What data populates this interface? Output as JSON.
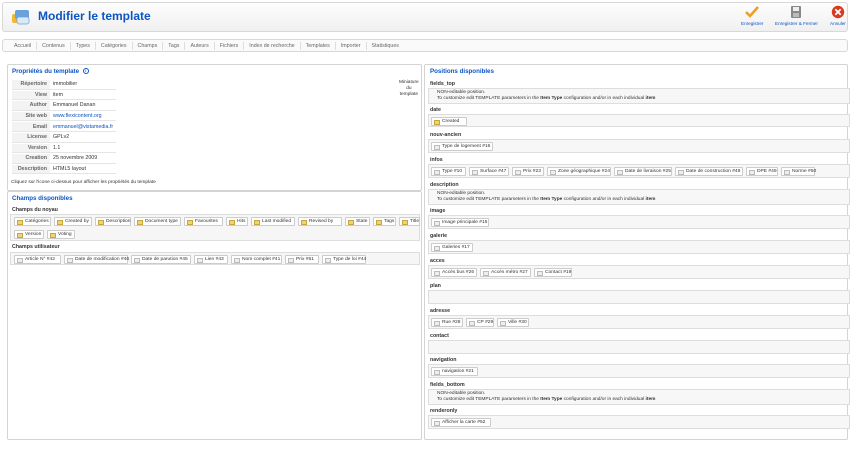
{
  "header": {
    "title": "Modifier le template",
    "toolbar": {
      "save": "Enregistrer",
      "save_close": "Enregistrer & Fermer",
      "cancel": "Annuler"
    }
  },
  "nav": [
    "Accueil",
    "Contenus",
    "Types",
    "Catégories",
    "Champs",
    "Tags",
    "Auteurs",
    "Fichiers",
    "Index de recherche",
    "Templates",
    "Importer",
    "Statistiques"
  ],
  "properties": {
    "title": "Propriétés du template",
    "rows": [
      {
        "k": "Répertoire",
        "v": "immobilier"
      },
      {
        "k": "View",
        "v": "item"
      },
      {
        "k": "Author",
        "v": "Emmanuel Danan"
      },
      {
        "k": "Site web",
        "v": "www.flexicontent.org",
        "link": true
      },
      {
        "k": "Email",
        "v": "emmanuel@vistamedia.fr",
        "link": true
      },
      {
        "k": "License",
        "v": "GPLv2"
      },
      {
        "k": "Version",
        "v": "1.1"
      },
      {
        "k": "Creation",
        "v": "25 novembre 2009"
      },
      {
        "k": "Description",
        "v": "HTML5 layout"
      }
    ],
    "help": "Cliquez sur l'icone ci-dessus pour afficher les propriétés du template",
    "thumb_label": [
      "Miniature",
      "du",
      "template"
    ]
  },
  "available": {
    "title": "Champs disponibles",
    "core_title": "Champs du noyau",
    "core": [
      "Catégories",
      "Created by",
      "Description",
      "Document type",
      "Favourites",
      "Hits",
      "Last modified",
      "Revised by",
      "State",
      "Tags",
      "Title",
      "Version",
      "Voting"
    ],
    "user_title": "Champs utilisateur",
    "user": [
      "Article N° #42",
      "Date de modification #46",
      "Date de parution #45",
      "Lien #43",
      "Nom complet #41",
      "Prix #51",
      "Type de loi #44"
    ]
  },
  "positions": {
    "title": "Positions disponibles",
    "note1": "NON-editable position.",
    "note2a": "To customize edit TEMPLATE parameters in the ",
    "note2b": "Item Type",
    "note2c": " configuration and/or in each individual ",
    "note2d": "item",
    "list": [
      {
        "name": "fields_top",
        "note": true
      },
      {
        "name": "date",
        "items": [
          "Created"
        ]
      },
      {
        "name": "nouv-ancien",
        "items": [
          "Type de logement #16"
        ]
      },
      {
        "name": "infos",
        "items": [
          "Type #10",
          "Surface #47",
          "Prix #23",
          "Zone géographique #24",
          "Date de livraison #25",
          "Date de construction #48",
          "DPE #49",
          "Norme #50"
        ]
      },
      {
        "name": "description",
        "note": true
      },
      {
        "name": "image",
        "items": [
          "Image principale #15"
        ]
      },
      {
        "name": "galerie",
        "items": [
          "Galeries #17"
        ]
      },
      {
        "name": "acces",
        "items": [
          "Accès bus #26",
          "Accès métro #27",
          "Contact #19"
        ]
      },
      {
        "name": "plan",
        "items": []
      },
      {
        "name": "adresse",
        "items": [
          "Rue #28",
          "CP #29",
          "Ville #30"
        ]
      },
      {
        "name": "contact",
        "items": []
      },
      {
        "name": "navigation",
        "items": [
          "navigation #21"
        ]
      },
      {
        "name": "fields_bottom",
        "note": true
      },
      {
        "name": "renderonly",
        "items": [
          "Afficher la carte #52"
        ]
      }
    ]
  }
}
